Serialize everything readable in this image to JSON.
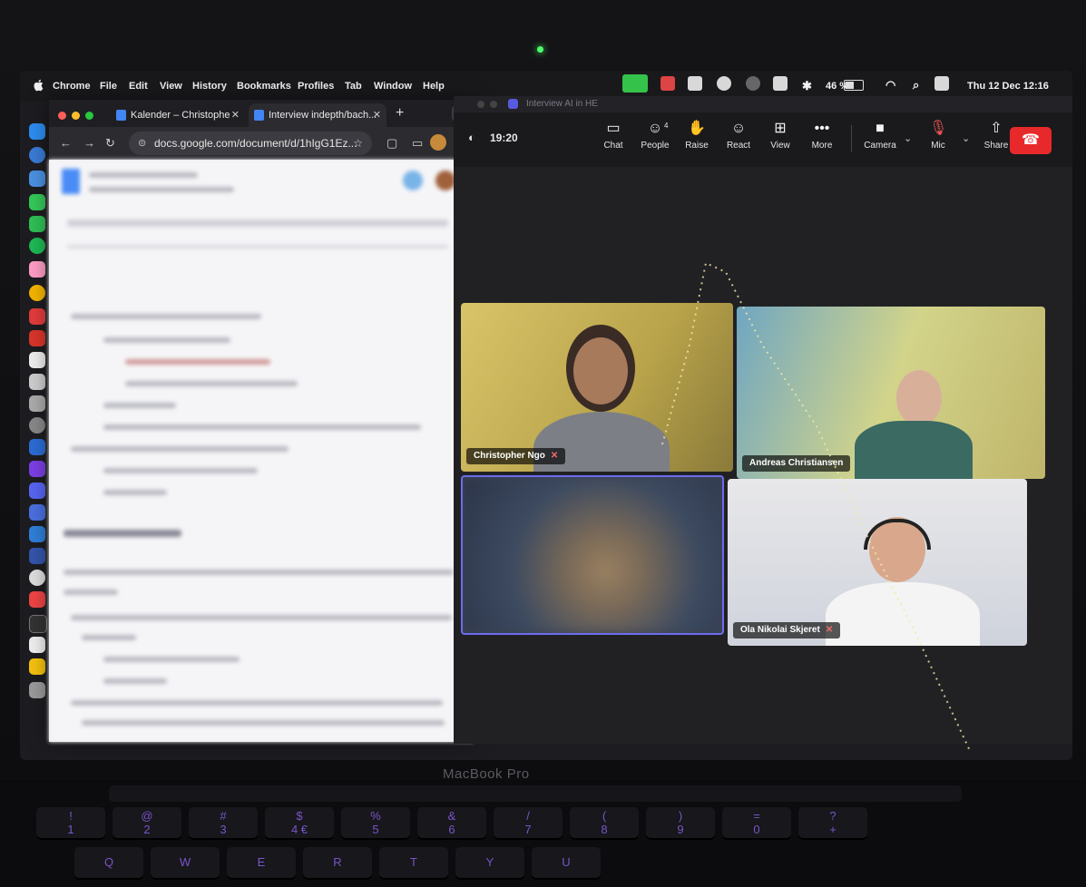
{
  "menubar": {
    "app_name": "Chrome",
    "items": [
      "File",
      "Edit",
      "View",
      "History",
      "Bookmarks",
      "Profiles",
      "Tab",
      "Window",
      "Help"
    ],
    "battery_percent": "46 %",
    "datetime": "Thu 12 Dec  12:16"
  },
  "chrome": {
    "tabs": [
      {
        "label": "Kalender – Christophe",
        "icon": "calendar-icon"
      },
      {
        "label": "Interview indepth/bach...",
        "icon": "docs-icon"
      }
    ],
    "url": "docs.google.com/document/d/1hIgG1Ez..."
  },
  "zoom": {
    "window_title": "Interview AI in HE",
    "timer": "19:20",
    "toolbar": {
      "chat": "Chat",
      "people": "People",
      "people_count": "4",
      "raise": "Raise",
      "react": "React",
      "view": "View",
      "more": "More",
      "camera": "Camera",
      "mic": "Mic",
      "share": "Share"
    },
    "participants": [
      {
        "name": "Christopher Ngo",
        "muted": true
      },
      {
        "name": "Andreas Christiansen",
        "muted": false
      },
      {
        "name": "",
        "muted": false
      },
      {
        "name": "Ola Nikolai Skjeret",
        "muted": true
      }
    ]
  },
  "laptop": {
    "model": "MacBook Pro"
  },
  "keyboard": {
    "row1": [
      "!\n1",
      "@\n2",
      "#\n3",
      "$\n4 €",
      "%\n5",
      "&\n6",
      "/\n7",
      "(\n8",
      ")\n9",
      "=\n0",
      "?\n+"
    ],
    "row2": [
      "Q",
      "W",
      "E",
      "R",
      "T",
      "Y",
      "U"
    ]
  },
  "colors": {
    "leave_button": "#e8292b",
    "active_speaker_border": "#6c6cf0",
    "keyboard_backlight": "#7a55c8"
  }
}
